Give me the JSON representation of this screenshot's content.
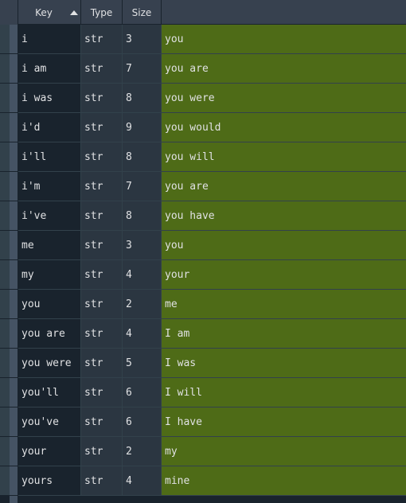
{
  "header": {
    "key": "Key",
    "type": "Type",
    "size": "Size",
    "value": ""
  },
  "sort_icon": "sort-ascending-icon",
  "colors": {
    "value_cell_bg": "#4e6b17",
    "background": "#19232d",
    "header_bg": "#37414f"
  },
  "rows": [
    {
      "key": "i",
      "type": "str",
      "size": "3",
      "value": "you"
    },
    {
      "key": "i am",
      "type": "str",
      "size": "7",
      "value": "you are"
    },
    {
      "key": "i was",
      "type": "str",
      "size": "8",
      "value": "you were"
    },
    {
      "key": "i'd",
      "type": "str",
      "size": "9",
      "value": "you would"
    },
    {
      "key": "i'll",
      "type": "str",
      "size": "8",
      "value": "you will"
    },
    {
      "key": "i'm",
      "type": "str",
      "size": "7",
      "value": "you are"
    },
    {
      "key": "i've",
      "type": "str",
      "size": "8",
      "value": "you have"
    },
    {
      "key": "me",
      "type": "str",
      "size": "3",
      "value": "you"
    },
    {
      "key": "my",
      "type": "str",
      "size": "4",
      "value": "your"
    },
    {
      "key": "you",
      "type": "str",
      "size": "2",
      "value": "me"
    },
    {
      "key": "you are",
      "type": "str",
      "size": "4",
      "value": "I am"
    },
    {
      "key": "you were",
      "type": "str",
      "size": "5",
      "value": "I was"
    },
    {
      "key": "you'll",
      "type": "str",
      "size": "6",
      "value": "I will"
    },
    {
      "key": "you've",
      "type": "str",
      "size": "6",
      "value": "I have"
    },
    {
      "key": "your",
      "type": "str",
      "size": "2",
      "value": "my"
    },
    {
      "key": "yours",
      "type": "str",
      "size": "4",
      "value": "mine"
    }
  ]
}
